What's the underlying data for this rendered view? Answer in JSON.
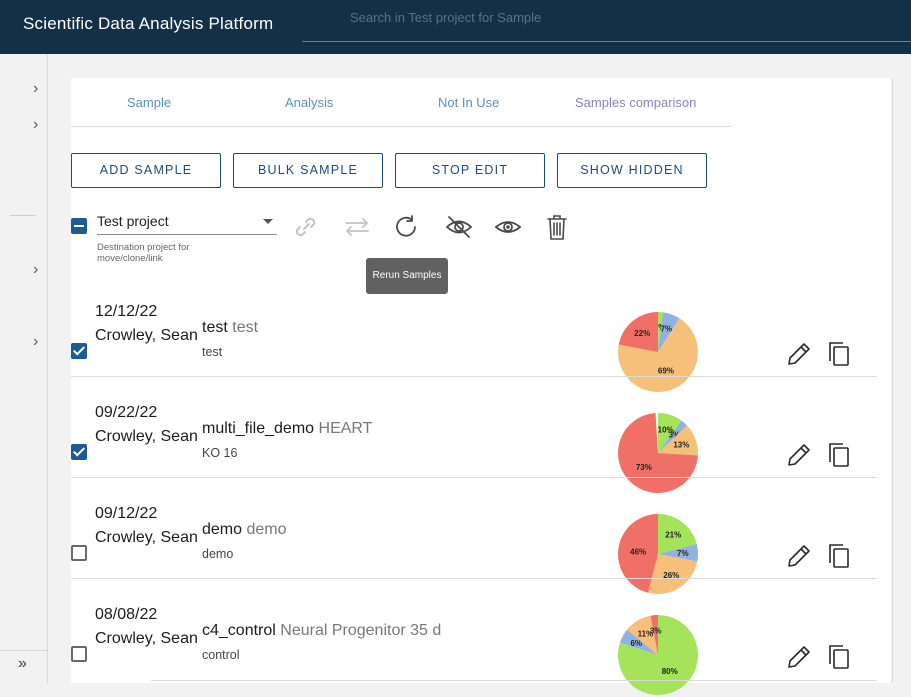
{
  "app": {
    "title": "Scientific Data Analysis Platform"
  },
  "search": {
    "placeholder": "Search in Test project for Sample"
  },
  "tabs": [
    {
      "label": "Sample"
    },
    {
      "label": "Analysis"
    },
    {
      "label": "Not In Use"
    },
    {
      "label": "Samples comparison"
    }
  ],
  "actions": {
    "add": "ADD SAMPLE",
    "bulk": "BULK SAMPLE",
    "stop_edit": "STOP EDIT",
    "show_hidden": "SHOW HIDDEN"
  },
  "project": {
    "value": "Test project",
    "helper": "Destination project for move/clone/link"
  },
  "toolbar_icons": [
    "link-icon",
    "swap-icon",
    "rerun-icon",
    "hide-icon",
    "show-icon",
    "delete-icon"
  ],
  "tooltip": "Rerun Samples",
  "colors": {
    "green": "#a4e35a",
    "blue": "#8fb2e0",
    "orange": "#f7c07a",
    "red": "#f07068"
  },
  "samples": [
    {
      "date": "12/12/22",
      "owner": "Crowley, Sean",
      "name": "test",
      "desc": "test",
      "sub": "test",
      "checked": true,
      "pie": [
        {
          "pct": 2,
          "color": "green",
          "label": "2%"
        },
        {
          "pct": 7,
          "color": "blue",
          "label": "7%"
        },
        {
          "pct": 69,
          "color": "orange",
          "label": "69%"
        },
        {
          "pct": 22,
          "color": "red",
          "label": "22%"
        }
      ]
    },
    {
      "date": "09/22/22",
      "owner": "Crowley, Sean",
      "name": "multi_file_demo",
      "desc": "HEART",
      "sub": "KO 16",
      "checked": true,
      "pie": [
        {
          "pct": 10,
          "color": "green",
          "label": "10%"
        },
        {
          "pct": 3,
          "color": "blue",
          "label": "3%"
        },
        {
          "pct": 13,
          "color": "orange",
          "label": "13%"
        },
        {
          "pct": 73,
          "color": "red",
          "label": "73%"
        }
      ]
    },
    {
      "date": "09/12/22",
      "owner": "Crowley, Sean",
      "name": "demo",
      "desc": "demo",
      "sub": "demo",
      "checked": false,
      "pie": [
        {
          "pct": 21,
          "color": "green",
          "label": "21%"
        },
        {
          "pct": 7,
          "color": "blue",
          "label": "7%"
        },
        {
          "pct": 26,
          "color": "orange",
          "label": "26%"
        },
        {
          "pct": 46,
          "color": "red",
          "label": "46%"
        }
      ]
    },
    {
      "date": "08/08/22",
      "owner": "Crowley, Sean",
      "name": "c4_control",
      "desc": "Neural Progenitor 35 d",
      "sub": "control",
      "checked": false,
      "pie": [
        {
          "pct": 80,
          "color": "green",
          "label": "80%"
        },
        {
          "pct": 6,
          "color": "blue",
          "label": "6%"
        },
        {
          "pct": 11,
          "color": "orange",
          "label": "11%"
        },
        {
          "pct": 3,
          "color": "red",
          "label": "3%"
        }
      ]
    }
  ]
}
